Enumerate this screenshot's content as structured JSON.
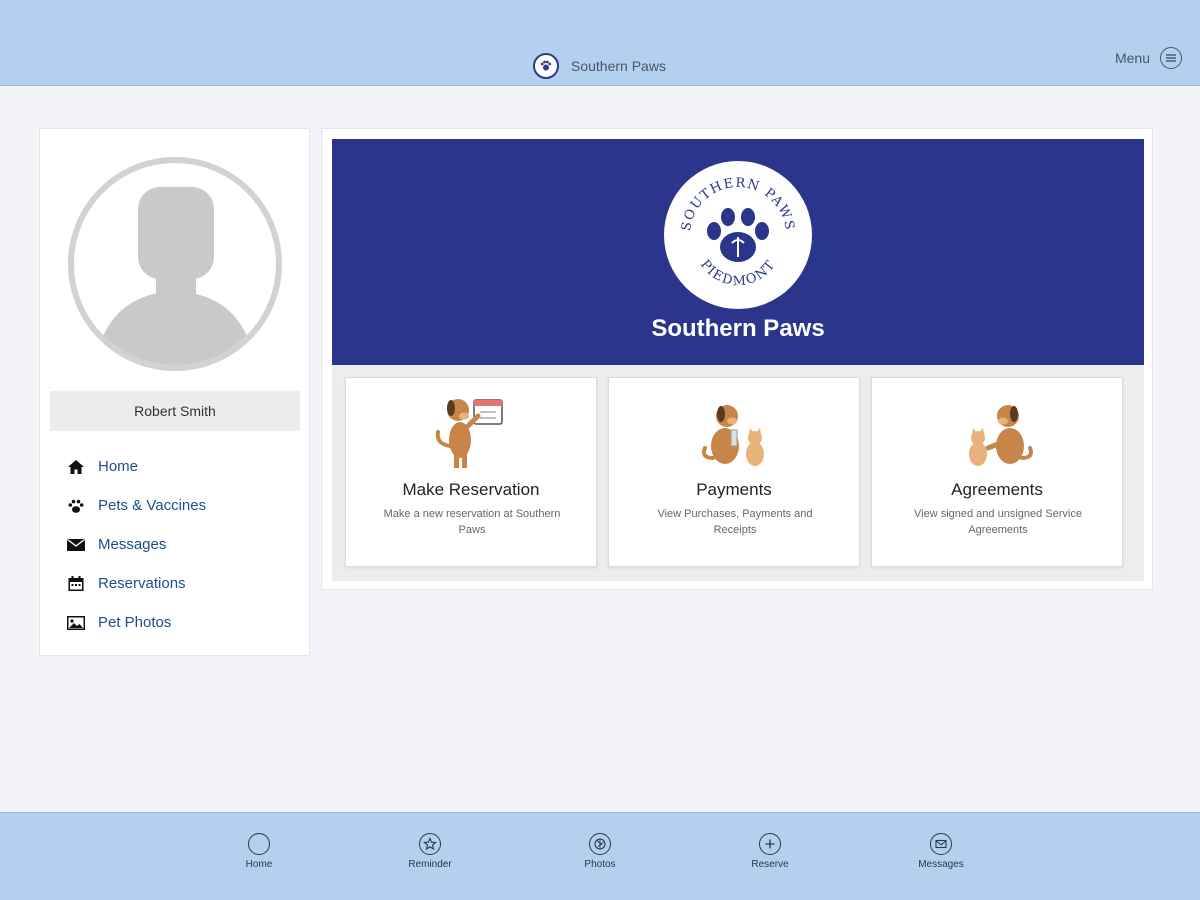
{
  "header": {
    "brand_name": "Southern Paws",
    "menu_label": "Menu"
  },
  "profile": {
    "user_name": "Robert Smith"
  },
  "nav": {
    "items": [
      {
        "label": "Home",
        "icon": "home-icon"
      },
      {
        "label": "Pets & Vaccines",
        "icon": "paw-icon"
      },
      {
        "label": "Messages",
        "icon": "envelope-icon"
      },
      {
        "label": "Reservations",
        "icon": "calendar-icon"
      },
      {
        "label": "Pet Photos",
        "icon": "image-icon"
      }
    ]
  },
  "hero": {
    "title": "Southern Paws",
    "logo_text_top": "SOUTHERN PAWS",
    "logo_text_bottom": "PIEDMONT"
  },
  "tiles": [
    {
      "title": "Make Reservation",
      "desc": "Make a new reservation at Southern Paws"
    },
    {
      "title": "Payments",
      "desc": "View Purchases, Payments and Receipts"
    },
    {
      "title": "Agreements",
      "desc": "View signed and unsigned Service Agreements"
    }
  ],
  "tabs": [
    {
      "label": "Home",
      "icon": "circle-icon"
    },
    {
      "label": "Reminder",
      "icon": "star-icon"
    },
    {
      "label": "Photos",
      "icon": "camera-aperture-icon"
    },
    {
      "label": "Reserve",
      "icon": "plus-icon"
    },
    {
      "label": "Messages",
      "icon": "mail-icon"
    }
  ],
  "colors": {
    "bar": "#b3d0ee",
    "hero": "#2b358c",
    "nav_link": "#1f4e8c"
  }
}
